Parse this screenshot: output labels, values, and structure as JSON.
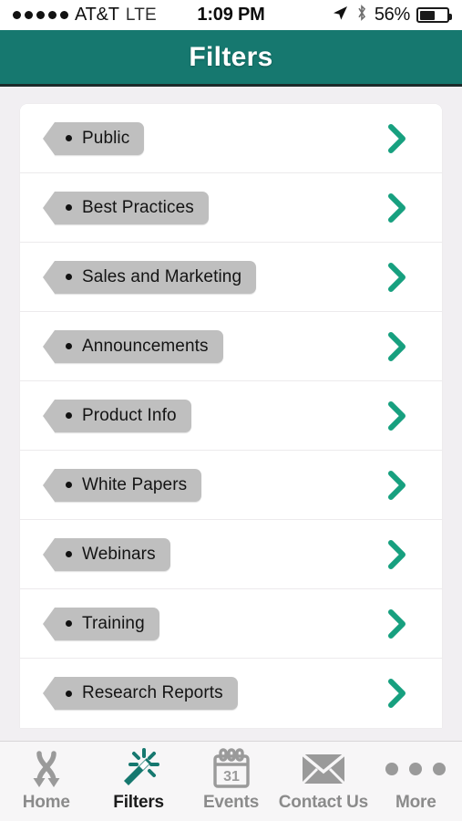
{
  "status_bar": {
    "signal_dots": 5,
    "carrier": "AT&T",
    "network": "LTE",
    "time": "1:09 PM",
    "battery_percent": "56%",
    "battery_level": 56,
    "location_icon": "location-arrow-icon",
    "bluetooth_icon": "bluetooth-icon"
  },
  "header": {
    "title": "Filters",
    "bg_color": "#16786f",
    "text_color": "#ffffff"
  },
  "theme": {
    "accent": "#16786f",
    "chevron_color": "#17a07f",
    "tag_bg": "#bfbfbf",
    "page_bg": "#f1eff2",
    "card_bg": "#ffffff"
  },
  "filters": {
    "items": [
      {
        "label": "Public"
      },
      {
        "label": "Best Practices"
      },
      {
        "label": "Sales and Marketing"
      },
      {
        "label": "Announcements"
      },
      {
        "label": "Product Info"
      },
      {
        "label": "White Papers"
      },
      {
        "label": "Webinars"
      },
      {
        "label": "Training"
      },
      {
        "label": "Research Reports"
      }
    ]
  },
  "tabbar": {
    "tabs": [
      {
        "label": "Home",
        "icon": "crossing-arrows-icon",
        "active": false
      },
      {
        "label": "Filters",
        "icon": "magic-wand-icon",
        "active": true
      },
      {
        "label": "Events",
        "icon": "calendar-icon",
        "active": false
      },
      {
        "label": "Contact Us",
        "icon": "envelope-icon",
        "active": false
      },
      {
        "label": "More",
        "icon": "ellipsis-icon",
        "active": false
      }
    ],
    "calendar_day": "31"
  }
}
